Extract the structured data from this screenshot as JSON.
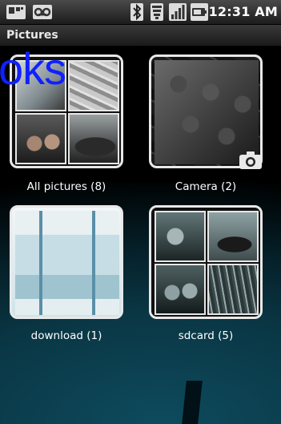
{
  "status_bar": {
    "time": "12:31 AM",
    "icons": [
      "sim-card-icon",
      "voicemail-icon",
      "bluetooth-icon",
      "wifi-icon",
      "signal-icon",
      "battery-icon"
    ]
  },
  "title_bar": {
    "title": "Pictures"
  },
  "overlay": {
    "text": "oks"
  },
  "albums": [
    {
      "label": "All pictures (8)"
    },
    {
      "label": "Camera (2)"
    },
    {
      "label": "download (1)"
    },
    {
      "label": "sdcard (5)"
    }
  ],
  "colors": {
    "overlay_text": "#1020ff",
    "frame": "#e8e8e8",
    "background_teal": "#0d4b5d"
  }
}
